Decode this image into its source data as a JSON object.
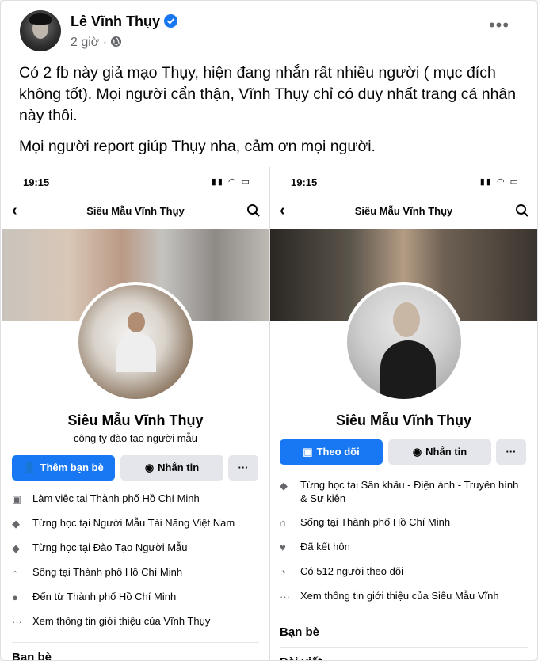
{
  "post": {
    "author": "Lê Vĩnh Thụy",
    "time": "2 giờ",
    "paragraphs": [
      "Có 2 fb này giả mạo Thụy, hiện đang nhắn rất nhiều người ( mục đích không tốt). Mọi người cẩn thận, Vĩnh Thụy chỉ có duy nhất trang cá nhân này thôi.",
      "Mọi người report giúp Thụy nha, cảm ơn mọi người."
    ]
  },
  "left": {
    "time": "19:15",
    "nav_title": "Siêu Mẫu Vĩnh Thụy",
    "name": "Siêu Mẫu Vĩnh Thụy",
    "subtitle": "công ty đào tạo người mẫu",
    "primary_btn": "Thêm bạn bè",
    "secondary_btn": "Nhắn tin",
    "more_btn": "···",
    "rows": [
      "Làm việc tại Thành phố Hồ Chí Minh",
      "Từng học tại Người Mẫu Tài Năng Việt Nam",
      "Từng học tại Đào Tạo Người Mẫu",
      "Sống tại Thành phố Hồ Chí Minh",
      "Đến từ Thành phố Hồ Chí Minh",
      "Xem thông tin giới thiệu của Vĩnh Thụy"
    ],
    "section": "Bạn bè"
  },
  "right": {
    "time": "19:15",
    "nav_title": "Siêu Mẫu Vĩnh Thụy",
    "name": "Siêu Mẫu Vĩnh Thụy",
    "primary_btn": "Theo dõi",
    "secondary_btn": "Nhắn tin",
    "more_btn": "···",
    "rows": [
      "Từng học tại Sân khấu - Điện ảnh - Truyền hình & Sự kiện",
      "Sống tại Thành phố Hồ Chí Minh",
      "Đã kết hôn",
      "Có 512 người theo dõi",
      "Xem thông tin giới thiệu của Siêu Mẫu Vĩnh"
    ],
    "section1": "Bạn bè",
    "section2": "Bài viết"
  },
  "colors": {
    "accent": "#1877f2",
    "muted": "#65676b"
  }
}
